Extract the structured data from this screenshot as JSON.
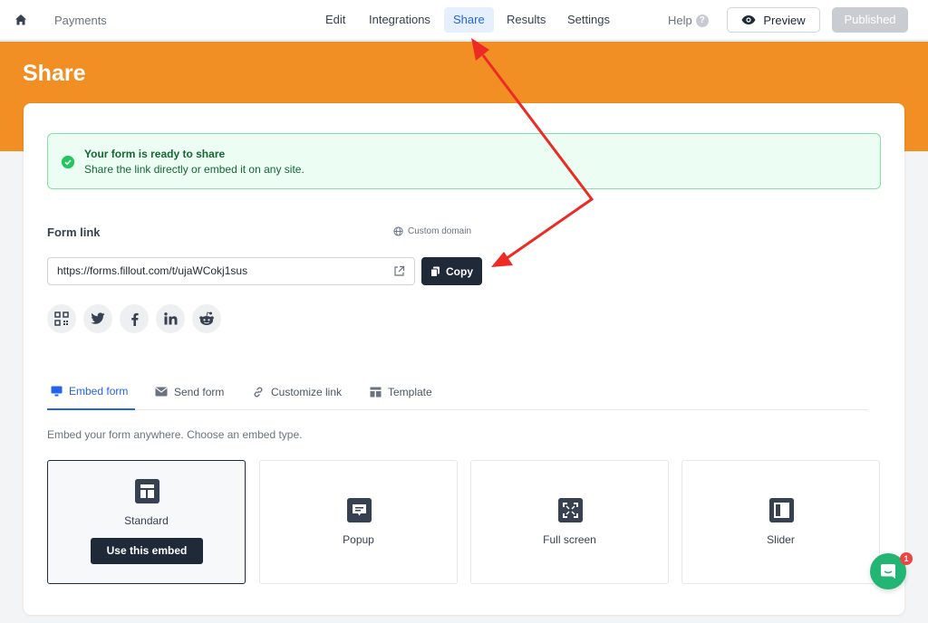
{
  "topnav": {
    "breadcrumb": "Payments",
    "tabs": [
      {
        "label": "Edit"
      },
      {
        "label": "Integrations"
      },
      {
        "label": "Share"
      },
      {
        "label": "Results"
      },
      {
        "label": "Settings"
      }
    ],
    "help_label": "Help",
    "help_icon_glyph": "?",
    "preview_label": "Preview",
    "published_label": "Published"
  },
  "page": {
    "title": "Share"
  },
  "alert": {
    "title": "Your form is ready to share",
    "body": "Share the link directly or embed it on any site.",
    "color": "#22c55e"
  },
  "form_link": {
    "label": "Form link",
    "custom_domain_label": "Custom domain",
    "url": "https://forms.fillout.com/t/ujaWCokj1sus",
    "copy_label": "Copy"
  },
  "social_icons": [
    "qr-code-icon",
    "twitter-icon",
    "facebook-icon",
    "linkedin-icon",
    "reddit-icon"
  ],
  "share_tabs": [
    {
      "label": "Embed form",
      "icon": "monitor-icon"
    },
    {
      "label": "Send form",
      "icon": "mail-icon"
    },
    {
      "label": "Customize link",
      "icon": "link-icon"
    },
    {
      "label": "Template",
      "icon": "template-icon"
    }
  ],
  "embed": {
    "description": "Embed your form anywhere. Choose an embed type.",
    "types": [
      {
        "label": "Standard",
        "selected": true
      },
      {
        "label": "Popup"
      },
      {
        "label": "Full screen"
      },
      {
        "label": "Slider"
      }
    ],
    "use_button_label": "Use this embed"
  },
  "chat": {
    "badge_count": "1"
  },
  "colors": {
    "accent_orange": "#f18f24",
    "active_blue": "#2563eb",
    "annotation_red": "#ee2a24"
  }
}
